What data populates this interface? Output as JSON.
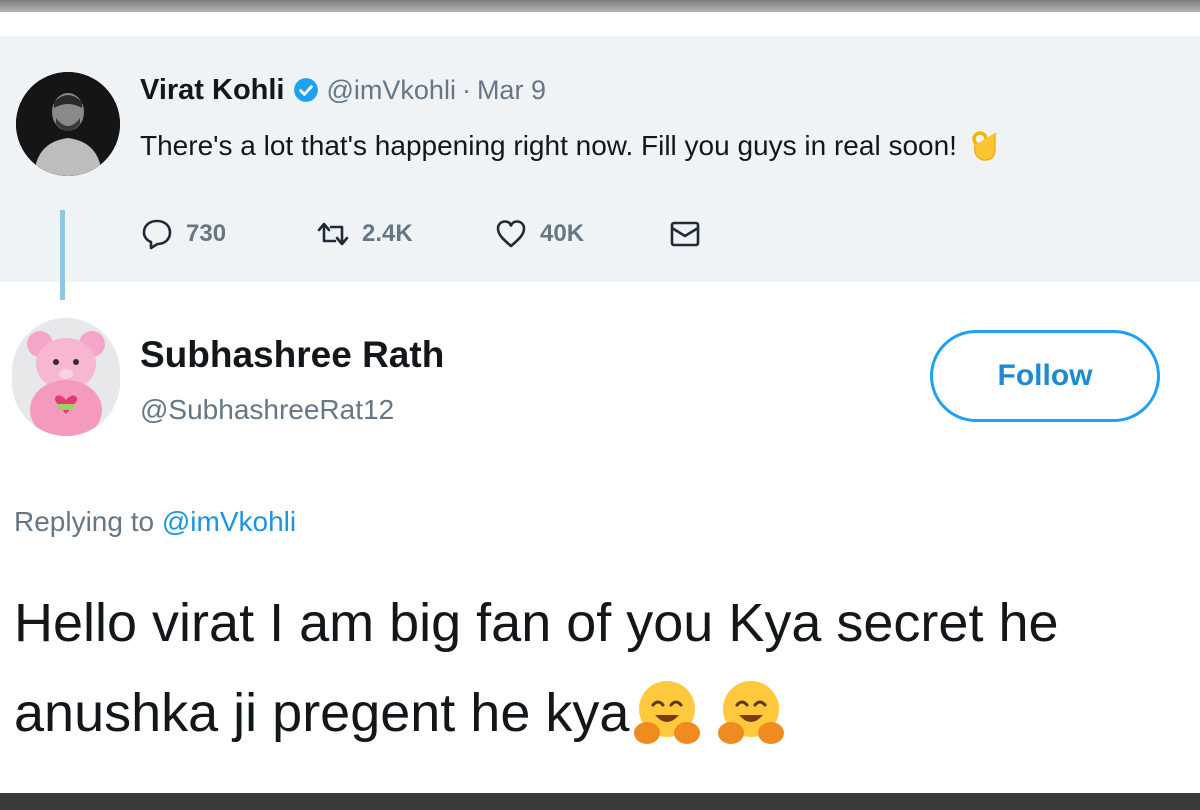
{
  "parent_tweet": {
    "author_name": "Virat Kohli",
    "verified": true,
    "handle": "@imVkohli",
    "separator": "·",
    "date": "Mar 9",
    "text": "There's a lot that's happening right now. Fill you guys in real soon!",
    "emoji": "ok-hand",
    "actions": {
      "reply": {
        "icon": "reply-icon",
        "count": "730"
      },
      "retweet": {
        "icon": "retweet-icon",
        "count": "2.4K"
      },
      "like": {
        "icon": "heart-icon",
        "count": "40K"
      },
      "message": {
        "icon": "envelope-icon"
      }
    }
  },
  "reply_tweet": {
    "author_name": "Subhashree Rath",
    "handle": "@SubhashreeRat12",
    "follow_label": "Follow",
    "replying_prefix": "Replying to",
    "replying_handle": "@imVkohli",
    "text_line1": "Hello virat I am big fan of you Kya secret he",
    "text_line2": "anushka ji pregent he kya",
    "trailing_emoji": [
      "hugging-face",
      "hugging-face"
    ]
  },
  "colors": {
    "parent_background": "#f0f3f6",
    "thread_line": "#8fc8e2",
    "brand_blue": "#1da1f2",
    "secondary_text": "#657786",
    "primary_text": "#14171a"
  }
}
